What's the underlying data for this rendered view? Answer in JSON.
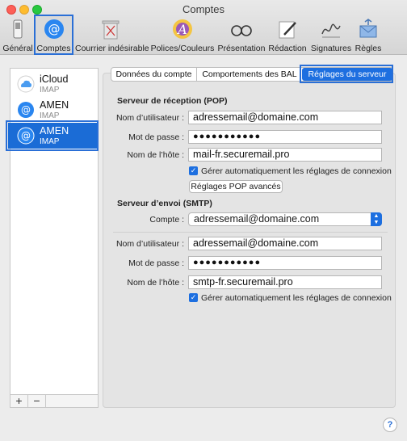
{
  "window": {
    "title": "Comptes"
  },
  "toolbar": [
    {
      "label": "Général",
      "icon": "switch-icon"
    },
    {
      "label": "Comptes",
      "icon": "at-sign-icon"
    },
    {
      "label": "Courrier indésirable",
      "icon": "trash-icon"
    },
    {
      "label": "Polices/Couleurs",
      "icon": "font-colors-icon"
    },
    {
      "label": "Présentation",
      "icon": "glasses-icon"
    },
    {
      "label": "Rédaction",
      "icon": "pen-icon"
    },
    {
      "label": "Signatures",
      "icon": "signature-icon"
    },
    {
      "label": "Règles",
      "icon": "rules-envelope-icon"
    }
  ],
  "accounts": [
    {
      "name": "iCloud",
      "type": "IMAP",
      "icon": "cloud-icon"
    },
    {
      "name": "AMEN",
      "type": "IMAP",
      "icon": "at-sign-icon"
    },
    {
      "name": "AMEN",
      "type": "IMAP",
      "icon": "at-sign-icon"
    }
  ],
  "sidebar_buttons": {
    "add": "+",
    "remove": "−"
  },
  "tabs": [
    "Données du compte",
    "Comportements des BAL",
    "Réglages du serveur"
  ],
  "incoming": {
    "title": "Serveur de réception (POP)",
    "username_label": "Nom d’utilisateur :",
    "username": "adressemail@domaine.com",
    "password_label": "Mot de passe :",
    "password": "●●●●●●●●●●●",
    "host_label": "Nom de l’hôte :",
    "host": "mail-fr.securemail.pro",
    "auto_manage": "Gérer automatiquement les réglages de connexion",
    "advanced_button": "Réglages POP avancés"
  },
  "outgoing": {
    "title": "Serveur d’envoi (SMTP)",
    "account_label": "Compte :",
    "account": "adressemail@domaine.com",
    "username_label": "Nom d’utilisateur :",
    "username": "adressemail@domaine.com",
    "password_label": "Mot de passe :",
    "password": "●●●●●●●●●●●",
    "host_label": "Nom de l’hôte :",
    "host": "smtp-fr.securemail.pro",
    "auto_manage": "Gérer automatiquement les réglages de connexion"
  },
  "help": "?",
  "colors": {
    "accent": "#1d6fe0",
    "highlight": "#2a6fd6"
  }
}
